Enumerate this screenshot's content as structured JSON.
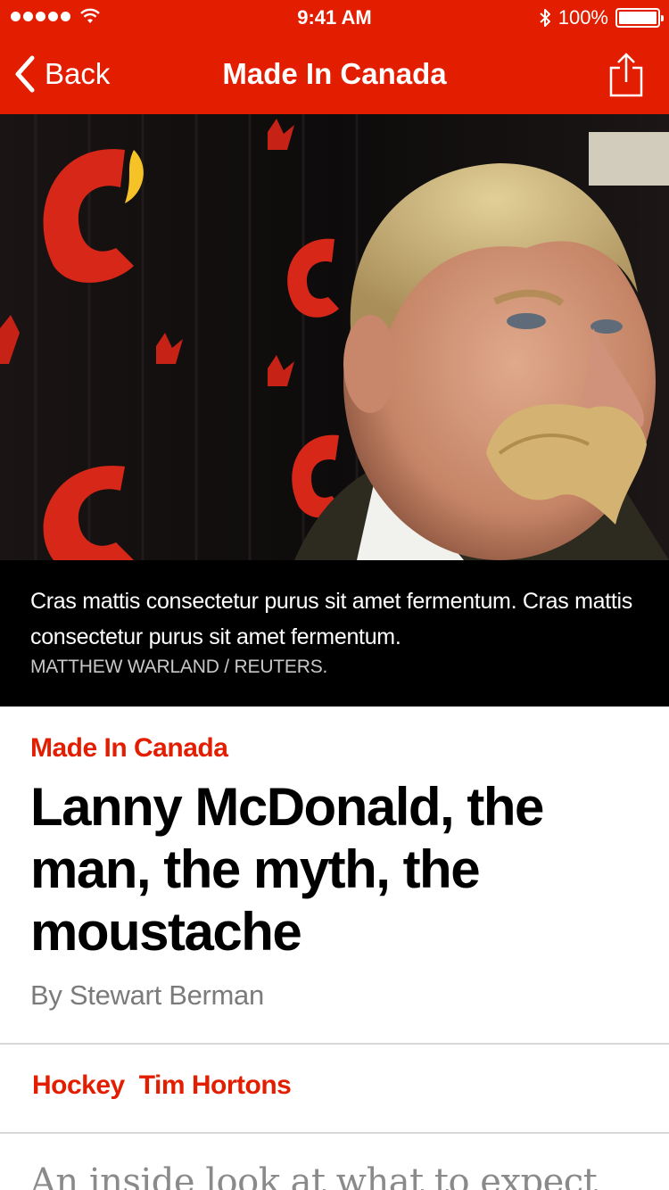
{
  "status_bar": {
    "time": "9:41 AM",
    "battery": "100%"
  },
  "nav": {
    "back_label": "Back",
    "title": "Made In Canada"
  },
  "hero": {
    "caption": "Cras mattis consectetur purus sit amet fermentum. Cras mattis consectetur purus sit amet fermentum.",
    "credit": "MATTHEW WARLAND / REUTERS."
  },
  "article": {
    "section": "Made In Canada",
    "headline": "Lanny McDonald, the man, the myth, the moustache",
    "byline": "By Stewart Berman",
    "tags": [
      "Hockey",
      "Tim Hortons"
    ],
    "intro": "An inside look at what to expect"
  },
  "colors": {
    "brand_red": "#e31e00",
    "caption_bg": "#000000",
    "byline_gray": "#7b7b7b"
  }
}
